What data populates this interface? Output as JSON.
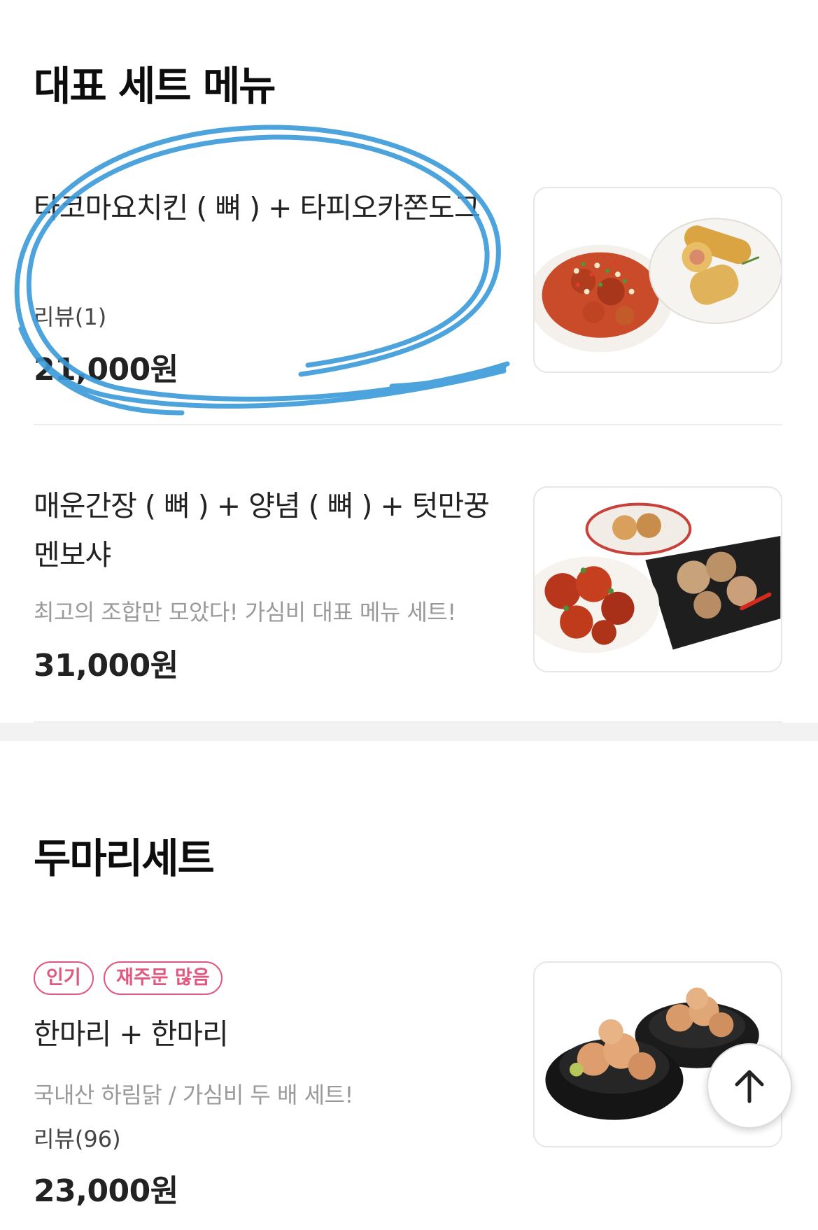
{
  "sections": [
    {
      "title": "대표 세트 메뉴",
      "items": [
        {
          "name": "타코마요치킨 ( 뼈 ) + 타피오카쫀도그",
          "review": "리뷰(1)",
          "price": "21,000원"
        },
        {
          "name": "매운간장 ( 뼈 ) + 양념 ( 뼈 ) + 텃만꿍멘보샤",
          "description": "최고의 조합만 모았다! 가심비 대표 메뉴 세트!",
          "price": "31,000원"
        }
      ]
    },
    {
      "title": "두마리세트",
      "items": [
        {
          "badges": [
            "인기",
            "재주문 많음"
          ],
          "name": "한마리 + 한마리",
          "description": "국내산 하림닭 / 가심비 두 배 세트!",
          "review": "리뷰(96)",
          "price": "23,000원"
        }
      ]
    }
  ],
  "colors": {
    "badge": "#e0577f",
    "scribble": "#3a9ad9",
    "divider": "#eeeeee"
  },
  "icons": {
    "scroll_top": "arrow-up-icon"
  }
}
